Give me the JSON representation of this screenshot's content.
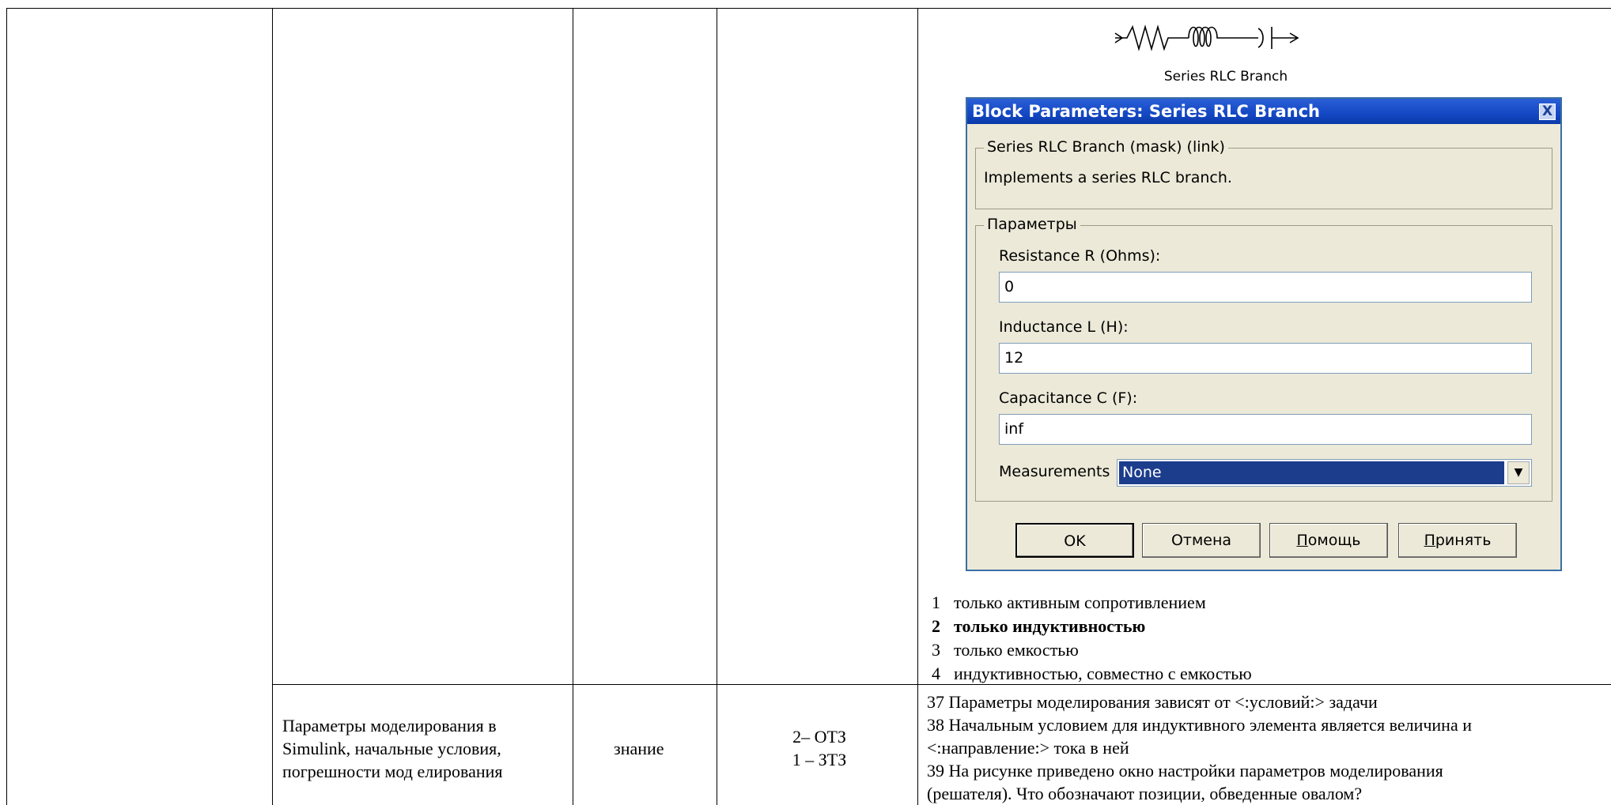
{
  "block_label": "Series RLC Branch",
  "dialog": {
    "title": "Block Parameters: Series RLC Branch",
    "close_glyph": "X",
    "mask_legend": "Series RLC Branch (mask) (link)",
    "description": "Implements a series RLC branch.",
    "params_legend": "Параметры",
    "resistance_label": "Resistance R (Ohms):",
    "resistance_value": "0",
    "inductance_label": "Inductance L (H):",
    "inductance_value": "12",
    "capacitance_label": "Capacitance C (F):",
    "capacitance_value": "inf",
    "measurements_label": "Measurements",
    "measurements_value": "None",
    "ok": "OK",
    "cancel": "Отмена",
    "help_first": "П",
    "help_rest": "омощь",
    "apply_first": "П",
    "apply_rest": "ринять"
  },
  "answers": [
    {
      "num": "1",
      "text": "только активным сопротивлением"
    },
    {
      "num": "2",
      "text": "только индуктивностью"
    },
    {
      "num": "3",
      "text": "только емкостью"
    },
    {
      "num": "4",
      "text": "индуктивностью, совместно с емкостью"
    }
  ],
  "row2": {
    "topic_line1": "Параметры моделирования в",
    "topic_line2": "Simulink, начальные условия,",
    "topic_line3": "погрешности мод елирования",
    "type": "знание",
    "code1": "2– ОТЗ",
    "code2": "1 – ЗТЗ",
    "q_lines": [
      "37 Параметры моделирования зависят от <:условий:> задачи",
      "38 Начальным условием для индуктивного элемента является величина и",
      "<:направление:> тока в ней",
      "39 На рисунке приведено окно настройки параметров моделирования",
      "(решателя). Что обозначают позиции, обведенные овалом?"
    ]
  }
}
